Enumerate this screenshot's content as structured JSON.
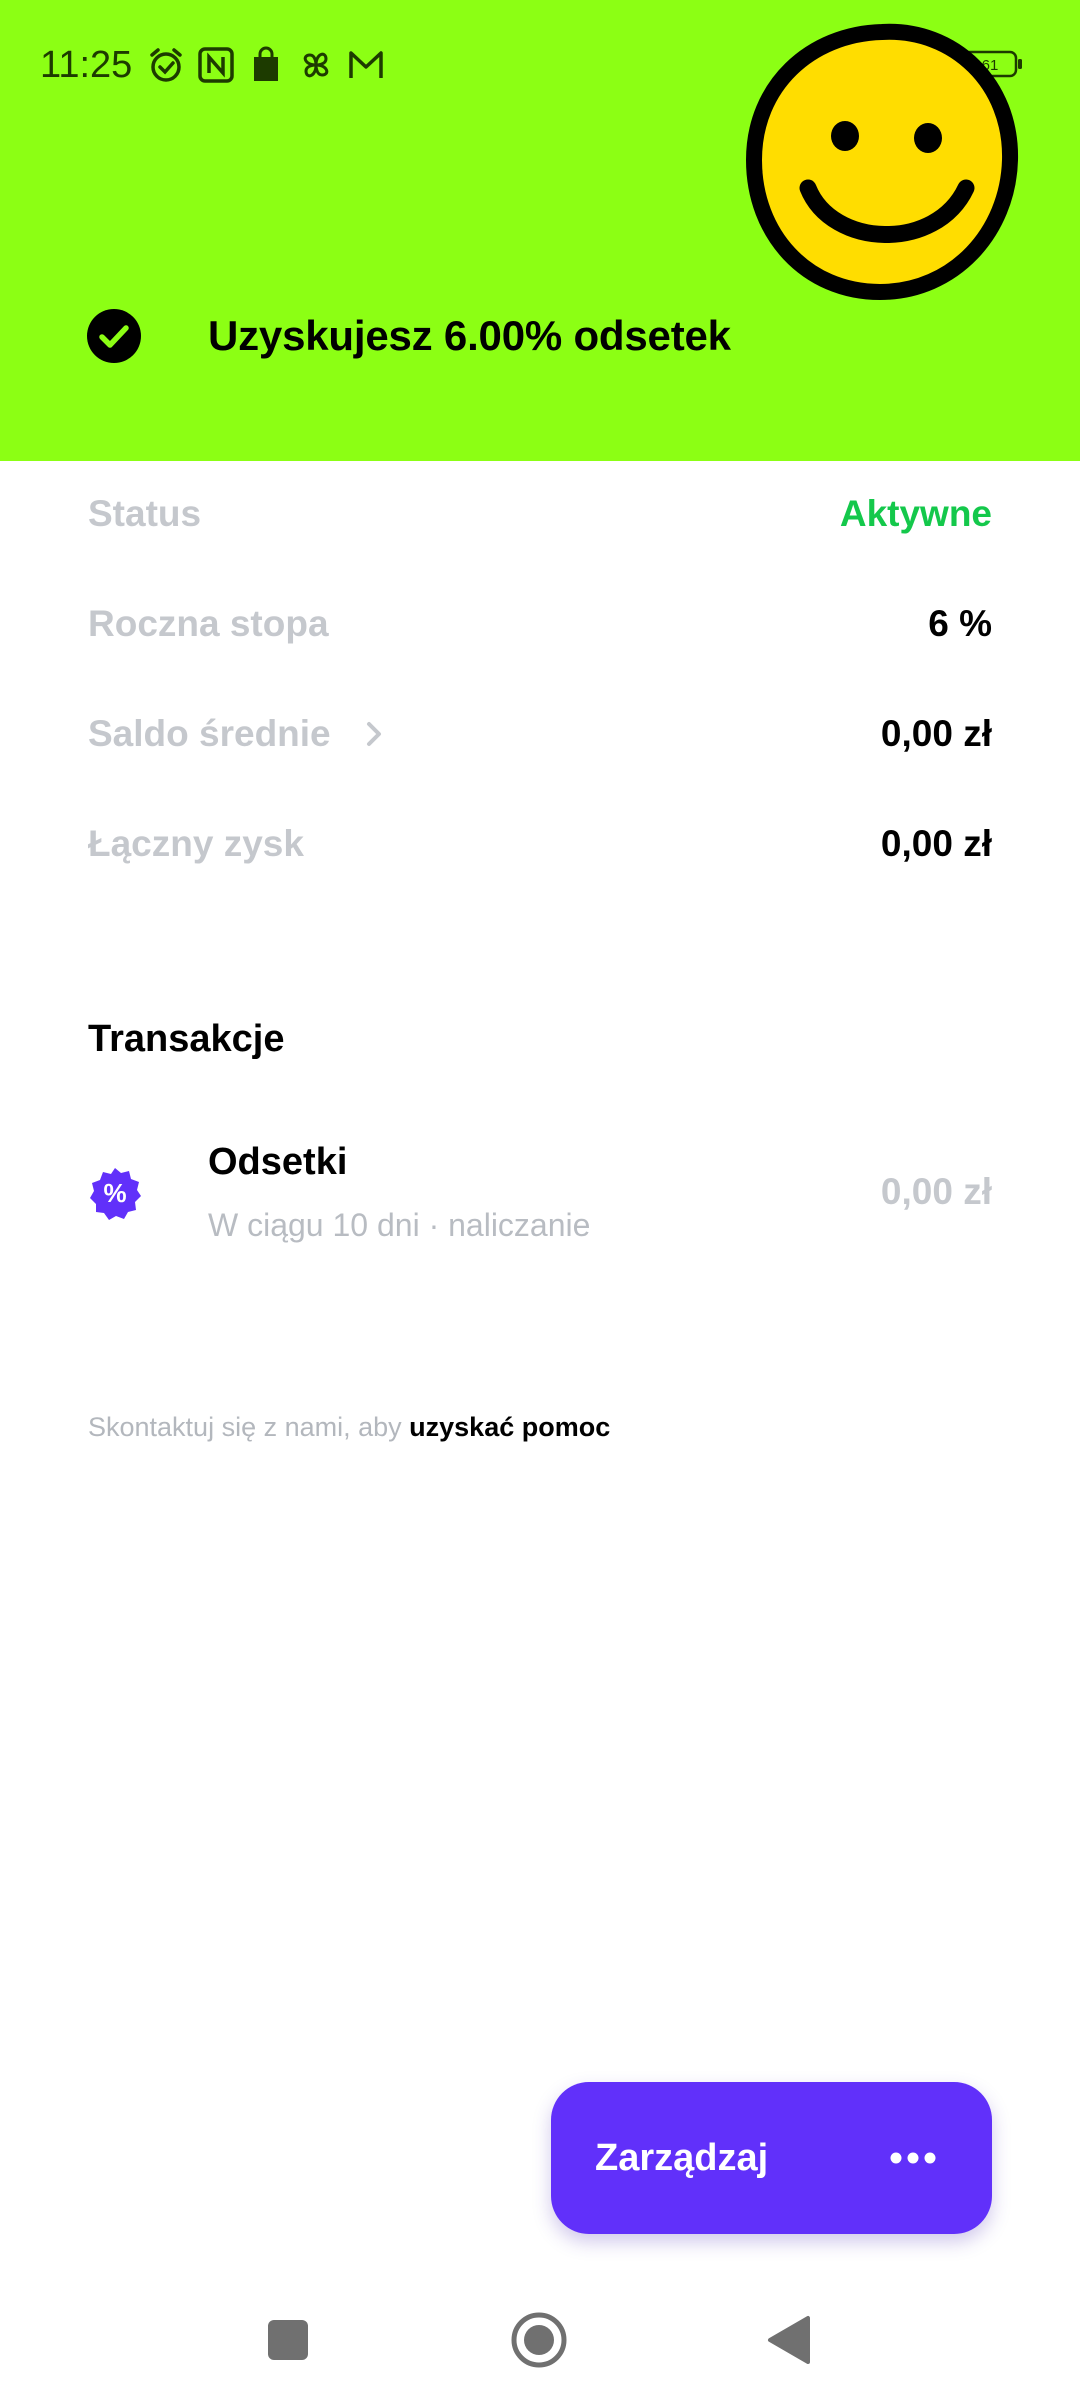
{
  "status_bar": {
    "time": "11:25",
    "battery": "61",
    "icons": [
      "alarm-icon",
      "nfc-icon",
      "shopping-bag-icon",
      "pinwheel-icon",
      "gmail-icon"
    ]
  },
  "hero": {
    "title": "Uzyskujesz 6.00% odsetek",
    "background": "#8cff14"
  },
  "details": [
    {
      "label": "Status",
      "value": "Aktywne"
    },
    {
      "label": "Roczna stopa",
      "value": "6 %"
    },
    {
      "label": "Saldo średnie",
      "value": "0,00 zł"
    },
    {
      "label": "Łączny zysk",
      "value": "0,00 zł"
    }
  ],
  "transactions": {
    "title": "Transakcje",
    "items": [
      {
        "title": "Odsetki",
        "subtitle": "W ciągu 10 dni · naliczanie",
        "amount": "0,00 zł",
        "icon": "percent-badge-icon"
      }
    ]
  },
  "help": {
    "prefix": "Skontaktuj się z nami, aby ",
    "link": "uzyskać pomoc"
  },
  "action": {
    "label": "Zarządzaj",
    "color": "#6130fa"
  },
  "colors": {
    "active_green": "#14c84b",
    "muted_label": "#c5c8cd"
  }
}
